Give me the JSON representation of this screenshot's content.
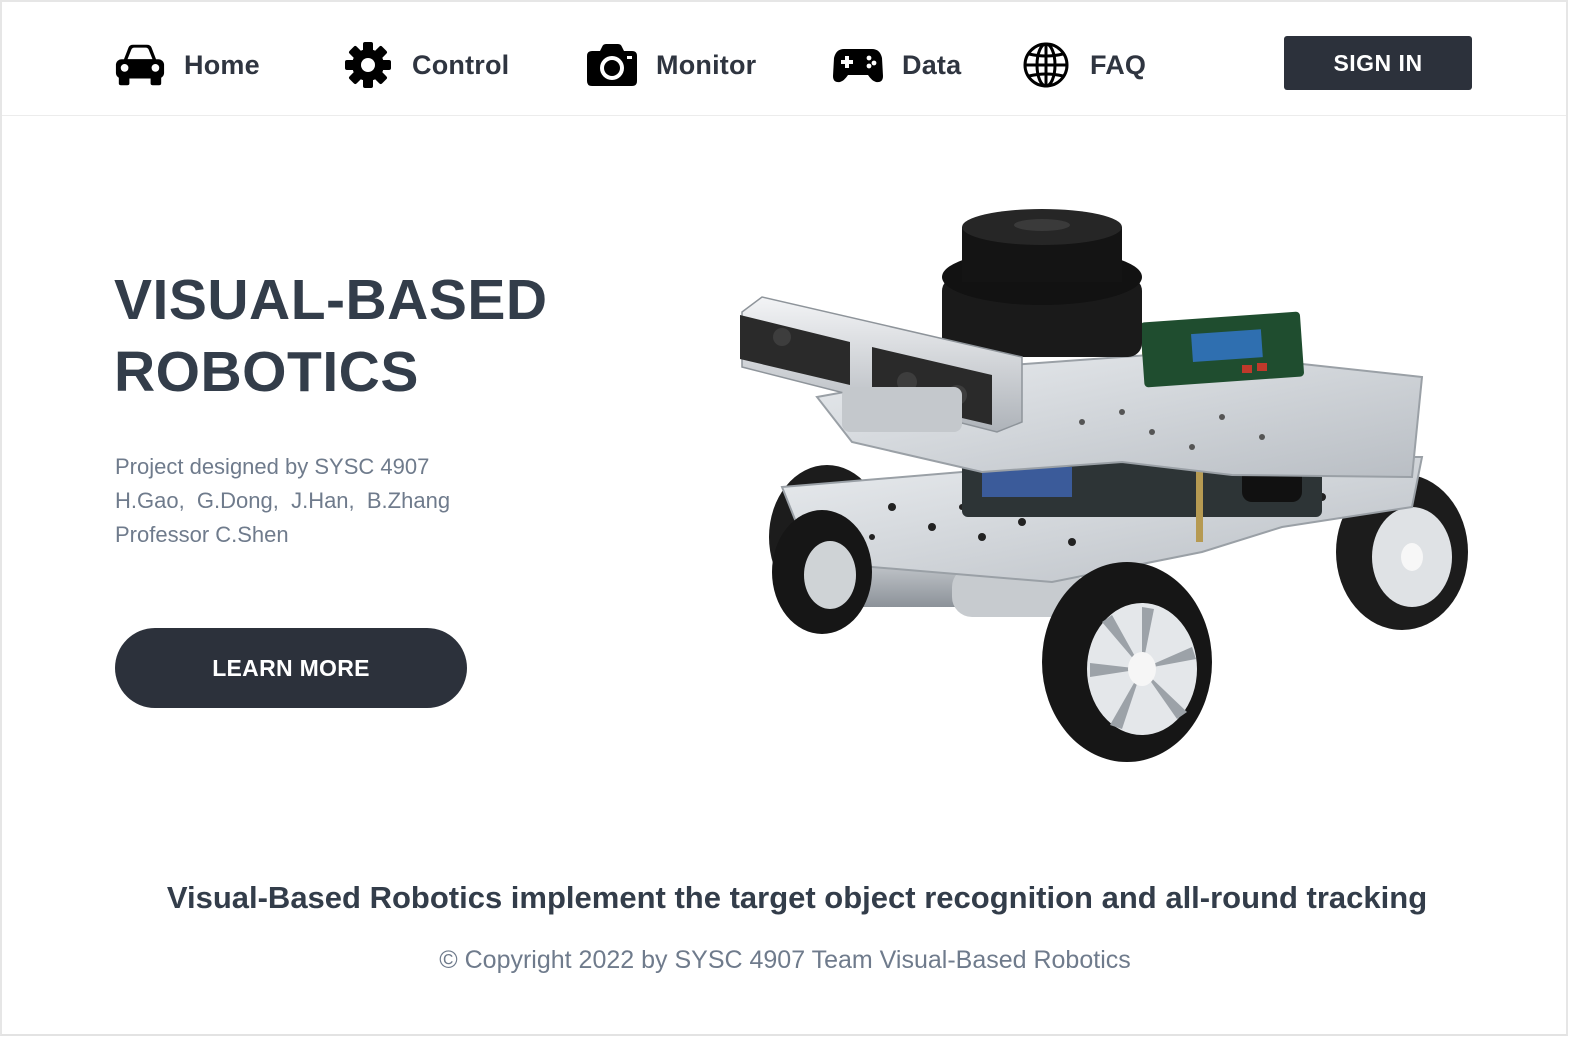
{
  "nav": {
    "items": [
      {
        "label": "Home",
        "icon": "car-icon"
      },
      {
        "label": "Control",
        "icon": "gear-icon"
      },
      {
        "label": "Monitor",
        "icon": "camera-icon"
      },
      {
        "label": "Data",
        "icon": "gamepad-icon"
      },
      {
        "label": "FAQ",
        "icon": "globe-icon"
      }
    ],
    "signin_label": "SIGN IN"
  },
  "hero": {
    "title_line1": "VISUAL-BASED",
    "title_line2": "ROBOTICS",
    "credits": [
      "Project designed by SYSC 4907",
      "H.Gao,  G.Dong,  J.Han,  B.Zhang",
      "Professor C.Shen"
    ],
    "learn_more_label": "LEARN MORE"
  },
  "footer": {
    "tagline": "Visual-Based Robotics implement the target object recognition and all-round tracking",
    "copyright": "© Copyright 2022 by SYSC 4907 Team Visual-Based Robotics"
  },
  "colors": {
    "button_bg": "#2c313b",
    "heading": "#333d4a",
    "muted_text": "#6f7b8c"
  }
}
